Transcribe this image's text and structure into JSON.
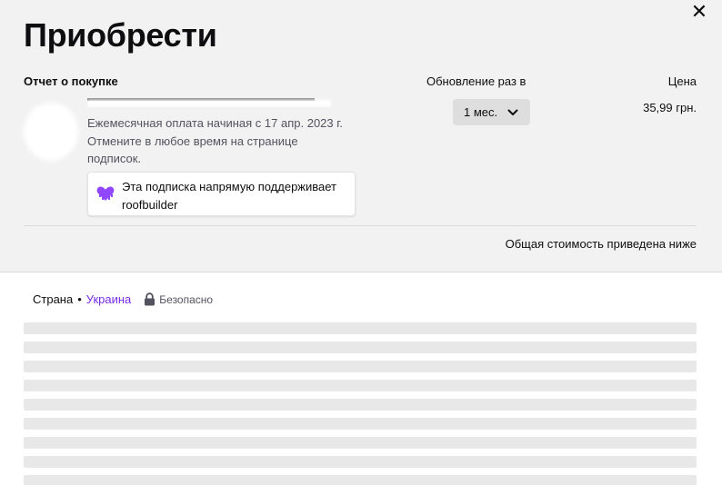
{
  "dialog": {
    "title": "Приобрести",
    "close_icon": "close-icon"
  },
  "summary": {
    "heading": "Отчет о покупке",
    "renew_heading": "Обновление раз в",
    "price_heading": "Цена"
  },
  "item": {
    "description": "Ежемесячная оплата начиная с 17 апр. 2023 г. Отмените в любое время на странице подписок.",
    "support_text": "Эта подписка напрямую поддерживает roofbuilder",
    "support_icon": "purple-heart-icon",
    "renew_value": "1 мес.",
    "price": "35,99 грн."
  },
  "total_note": "Общая стоимость приведена ниже",
  "country": {
    "label": "Страна",
    "separator": "•",
    "value": "Украина",
    "secure_label": "Безопасно",
    "lock_icon": "lock-icon"
  },
  "colors": {
    "accent": "#772ce8",
    "top_bg": "#f2f2f2",
    "skeleton": "#e8e8e8"
  }
}
